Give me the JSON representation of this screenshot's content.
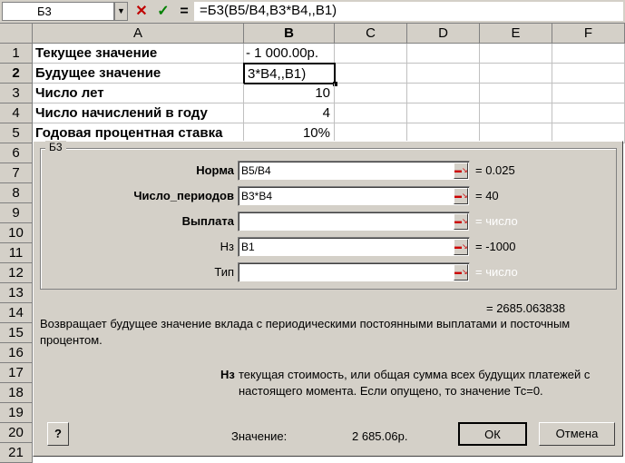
{
  "formula_bar": {
    "name_box": "Б3",
    "cancel_symbol": "✕",
    "enter_symbol": "✓",
    "equals_symbol": "=",
    "formula": "=Б3(B5/B4,B3*B4,,B1)"
  },
  "grid": {
    "columns": [
      "A",
      "B",
      "C",
      "D",
      "E",
      "F"
    ],
    "rows": [
      "1",
      "2",
      "3",
      "4",
      "5",
      "6",
      "7",
      "8",
      "9",
      "10",
      "11",
      "12",
      "13",
      "14",
      "15",
      "16",
      "17",
      "18",
      "19",
      "20",
      "21"
    ],
    "cells": {
      "a1": "Текущее значение",
      "b1": "- 1 000.00р.",
      "a2": "Будущее значение",
      "b2": "3*B4,,B1)",
      "a3": "Число лет",
      "b3": "10",
      "a4": "Число начислений в году",
      "b4": "4",
      "a5": "Годовая процентная ставка",
      "b5": "10%"
    }
  },
  "dialog": {
    "group_title": "Б3",
    "args": [
      {
        "label": "Норма",
        "value": "B5/B4",
        "result": "= 0.025"
      },
      {
        "label": "Число_периодов",
        "value": "B3*B4",
        "result": "= 40"
      },
      {
        "label": "Выплата",
        "value": "",
        "result": "= число"
      },
      {
        "label": "Нз",
        "value": "B1",
        "result": "= -1000"
      },
      {
        "label": "Тип",
        "value": "",
        "result": "= число"
      }
    ],
    "total_result": "= 2685.063838",
    "description": "Возвращает будущее значение вклада  с периодическими постоянными выплатами и посточным процентом.",
    "arg_help_name": "Нз",
    "arg_help_text_1": "текущая стоимость, или общая сумма всех будущих платежей с",
    "arg_help_text_2": "настоящего момента. Если опущено, то значение Тс=0.",
    "help_button": "?",
    "value_label": "Значение:",
    "value": "2 685.06р.",
    "ok_label": "ОК",
    "cancel_label": "Отмена"
  },
  "colors": {
    "face": "#d4d0c8",
    "cancel_red": "#c00000",
    "enter_green": "#008000",
    "placeholder_result": "#ffffff"
  }
}
